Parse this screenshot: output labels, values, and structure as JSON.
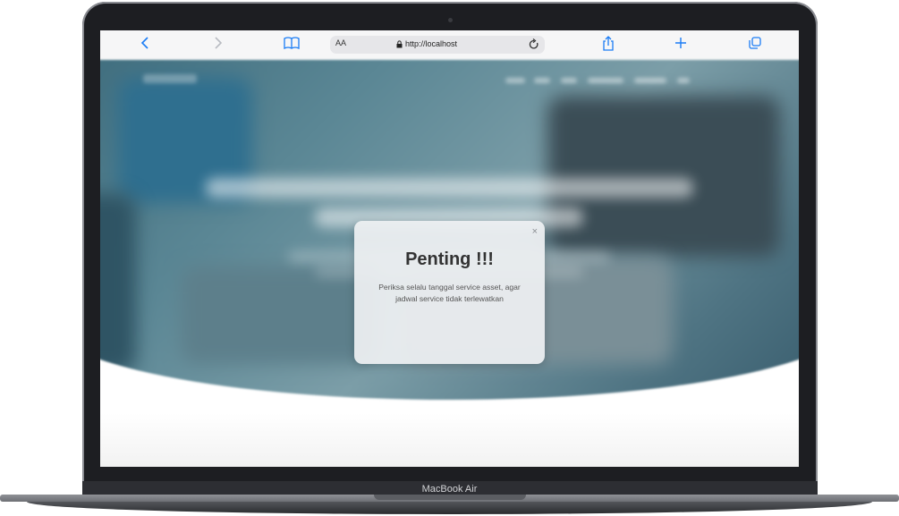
{
  "browser": {
    "reader_label": "AA",
    "url": "http://localhost",
    "buttons": {
      "back_icon": "chevron-left-icon",
      "forward_icon": "chevron-right-icon",
      "bookmarks_icon": "book-icon",
      "reload_icon": "reload-icon",
      "share_icon": "share-icon",
      "new_tab_icon": "plus-icon",
      "tabs_icon": "tabs-icon"
    }
  },
  "modal": {
    "title": "Penting !!!",
    "body": "Periksa selalu tanggal service asset, agar jadwal service tidak terlewatkan",
    "close_label": "×"
  },
  "device": {
    "label": "MacBook Air"
  },
  "colors": {
    "safari_accent": "#1a7cf5",
    "hero_tint": "#5b8795",
    "modal_bg": "#eef0f2"
  }
}
